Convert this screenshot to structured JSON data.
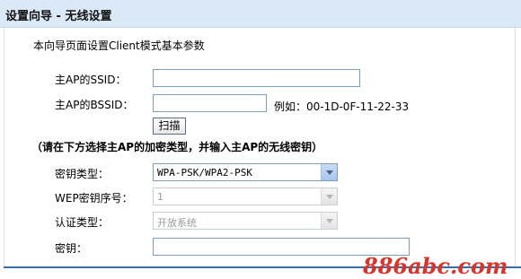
{
  "header": {
    "title": "设置向导 - 无线设置"
  },
  "intro": "本向导页面设置Client模式基本参数",
  "fields": {
    "ssid": {
      "label": "主AP的SSID：",
      "value": ""
    },
    "bssid": {
      "label": "主AP的BSSID：",
      "value": "",
      "example": "例如：00-1D-0F-11-22-33"
    }
  },
  "scan_button": "扫描",
  "note": "（请在下方选择主AP的加密类型，并输入主AP的无线密钥）",
  "security": {
    "cipher_type": {
      "label": "密钥类型：",
      "value": "WPA-PSK/WPA2-PSK"
    },
    "wep_index": {
      "label": "WEP密钥序号：",
      "value": "1"
    },
    "auth_type": {
      "label": "认证类型：",
      "value": "开放系统"
    },
    "key": {
      "label": "密钥：",
      "value": ""
    }
  },
  "watermark": "886abc.com",
  "colors": {
    "header_bg": "#dbe9f7",
    "accent_line": "#3a6ea5",
    "watermark": "#d9342b"
  }
}
